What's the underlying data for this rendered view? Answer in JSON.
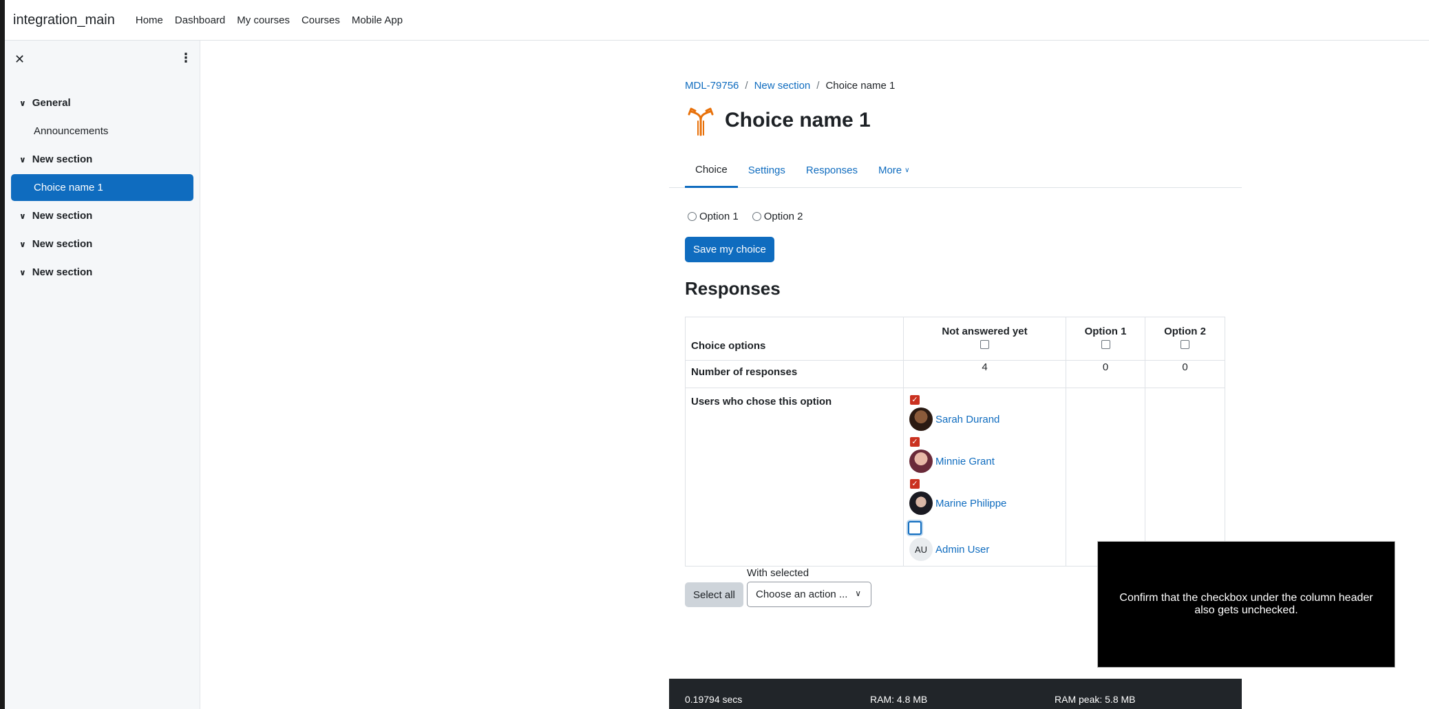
{
  "navbar": {
    "brand": "integration_main",
    "links": [
      "Home",
      "Dashboard",
      "My courses",
      "Courses",
      "Mobile App"
    ]
  },
  "drawer": {
    "close_icon": "close-icon",
    "menu_icon": "kebab-icon",
    "sections": [
      {
        "label": "General"
      },
      {
        "label": "Announcements"
      },
      {
        "label": "New section"
      },
      {
        "label": "Choice name 1"
      },
      {
        "label": "New section"
      },
      {
        "label": "New section"
      },
      {
        "label": "New section"
      }
    ]
  },
  "breadcrumb": [
    "MDL-79756",
    "New section",
    "Choice name 1"
  ],
  "page": {
    "title": "Choice name 1",
    "tabs": [
      "Choice",
      "Settings",
      "Responses",
      "More"
    ],
    "options": [
      "Option 1",
      "Option 2"
    ],
    "save_label": "Save my choice",
    "responses_heading": "Responses"
  },
  "table": {
    "row_labels": [
      "Choice options",
      "Number of responses",
      "Users who chose this option"
    ],
    "columns": [
      "Not answered yet",
      "Option 1",
      "Option 2"
    ],
    "counts": [
      "4",
      "0",
      "0"
    ],
    "users": [
      {
        "name": "Sarah Durand",
        "checked": true
      },
      {
        "name": "Minnie Grant",
        "checked": true
      },
      {
        "name": "Marine Philippe",
        "checked": true
      },
      {
        "name": "Admin User",
        "checked": false,
        "initials": "AU"
      }
    ]
  },
  "actions": {
    "select_all": "Select all",
    "with_selected": "With selected",
    "action_placeholder": "Choose an action ..."
  },
  "footer": {
    "time": "0.19794 secs",
    "ram": "RAM: 4.8 MB",
    "ram_peak": "RAM peak: 5.8 MB"
  },
  "toast": {
    "message": "Confirm that the checkbox under the column header also gets unchecked."
  },
  "colors": {
    "primary": "#0f6cbf",
    "checked": "#ca3120",
    "footer": "#212529"
  }
}
